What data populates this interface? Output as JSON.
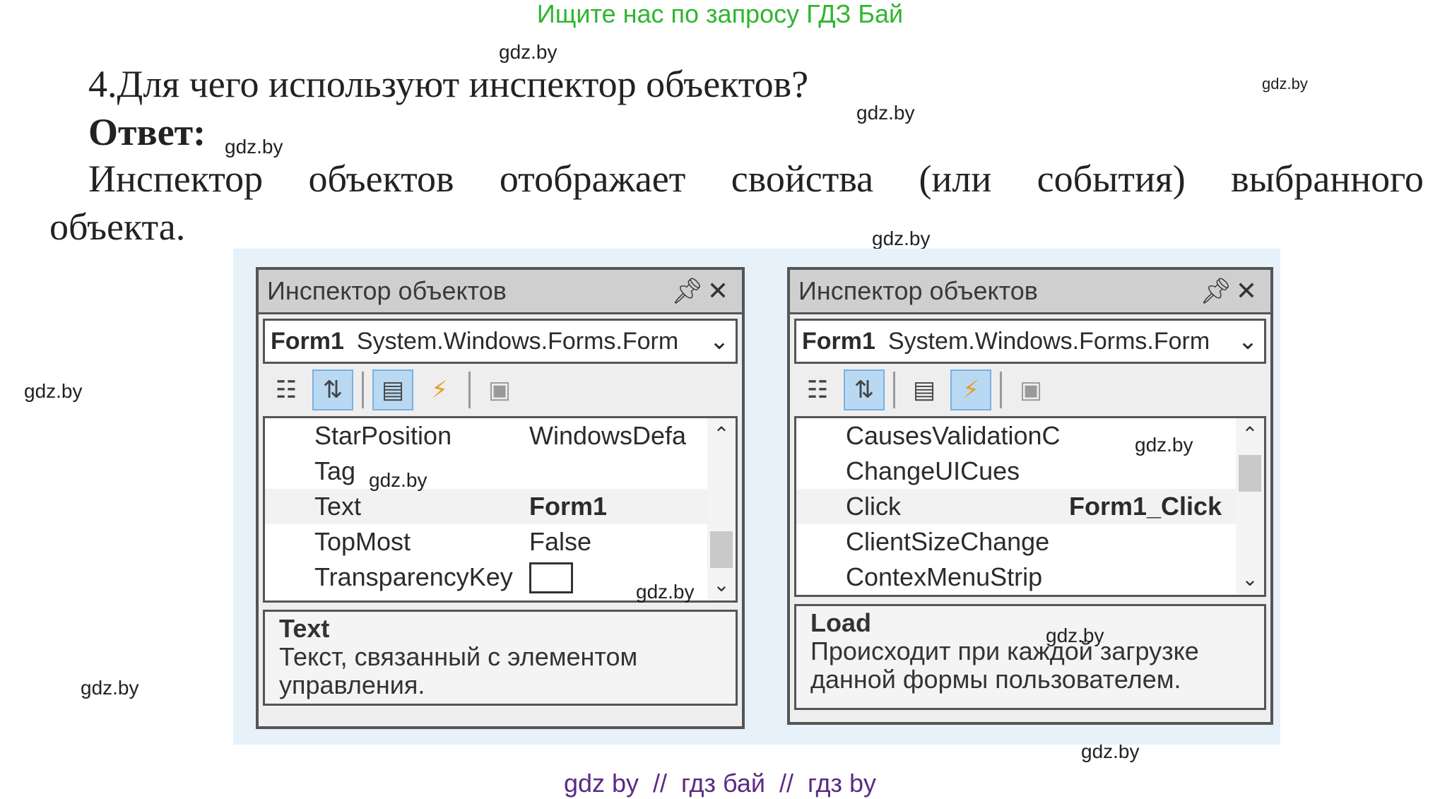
{
  "top_banner": "Ищите нас по запросу ГДЗ Бай",
  "watermark": "gdz.by",
  "question": "4.Для чего используют инспектор объектов?",
  "answer_label": "Ответ:",
  "answer_words": [
    "Инспектор",
    "объектов",
    "отображает",
    "свойства",
    "(или",
    "события)",
    "выбранного"
  ],
  "answer_line2": "объекта.",
  "left_panel": {
    "title": "Инспектор объектов",
    "pin_icon": "pin-icon",
    "close_icon": "close-icon",
    "combo_object": "Form1",
    "combo_type": "System.Windows.Forms.Form",
    "rows": [
      {
        "name": "StarPosition",
        "value": "WindowsDefa",
        "bold": false
      },
      {
        "name": "Tag",
        "value": "",
        "bold": false
      },
      {
        "name": "Text",
        "value": "Form1",
        "bold": true
      },
      {
        "name": "TopMost",
        "value": "False",
        "bold": false
      },
      {
        "name": "TransparencyKey",
        "value": "",
        "bold": false
      }
    ],
    "desc_title": "Text",
    "desc_line1": "Текст, связанный с элементом",
    "desc_line2": "управления."
  },
  "right_panel": {
    "title": "Инспектор объектов",
    "combo_object": "Form1",
    "combo_type": "System.Windows.Forms.Form",
    "rows": [
      {
        "name": "CausesValidationC",
        "value": "",
        "bold": false
      },
      {
        "name": "ChangeUICues",
        "value": "",
        "bold": false
      },
      {
        "name": "Click",
        "value": "Form1_Click",
        "bold": true
      },
      {
        "name": "ClientSizeChange",
        "value": "",
        "bold": false
      },
      {
        "name": "ContexMenuStrip",
        "value": "",
        "bold": false
      }
    ],
    "desc_title": "Load",
    "desc_line1": "Происходит при каждой загрузке",
    "desc_line2": "данной формы пользователем."
  },
  "bottom_banner": "gdz by  //  гдз бай  //  гдз by"
}
